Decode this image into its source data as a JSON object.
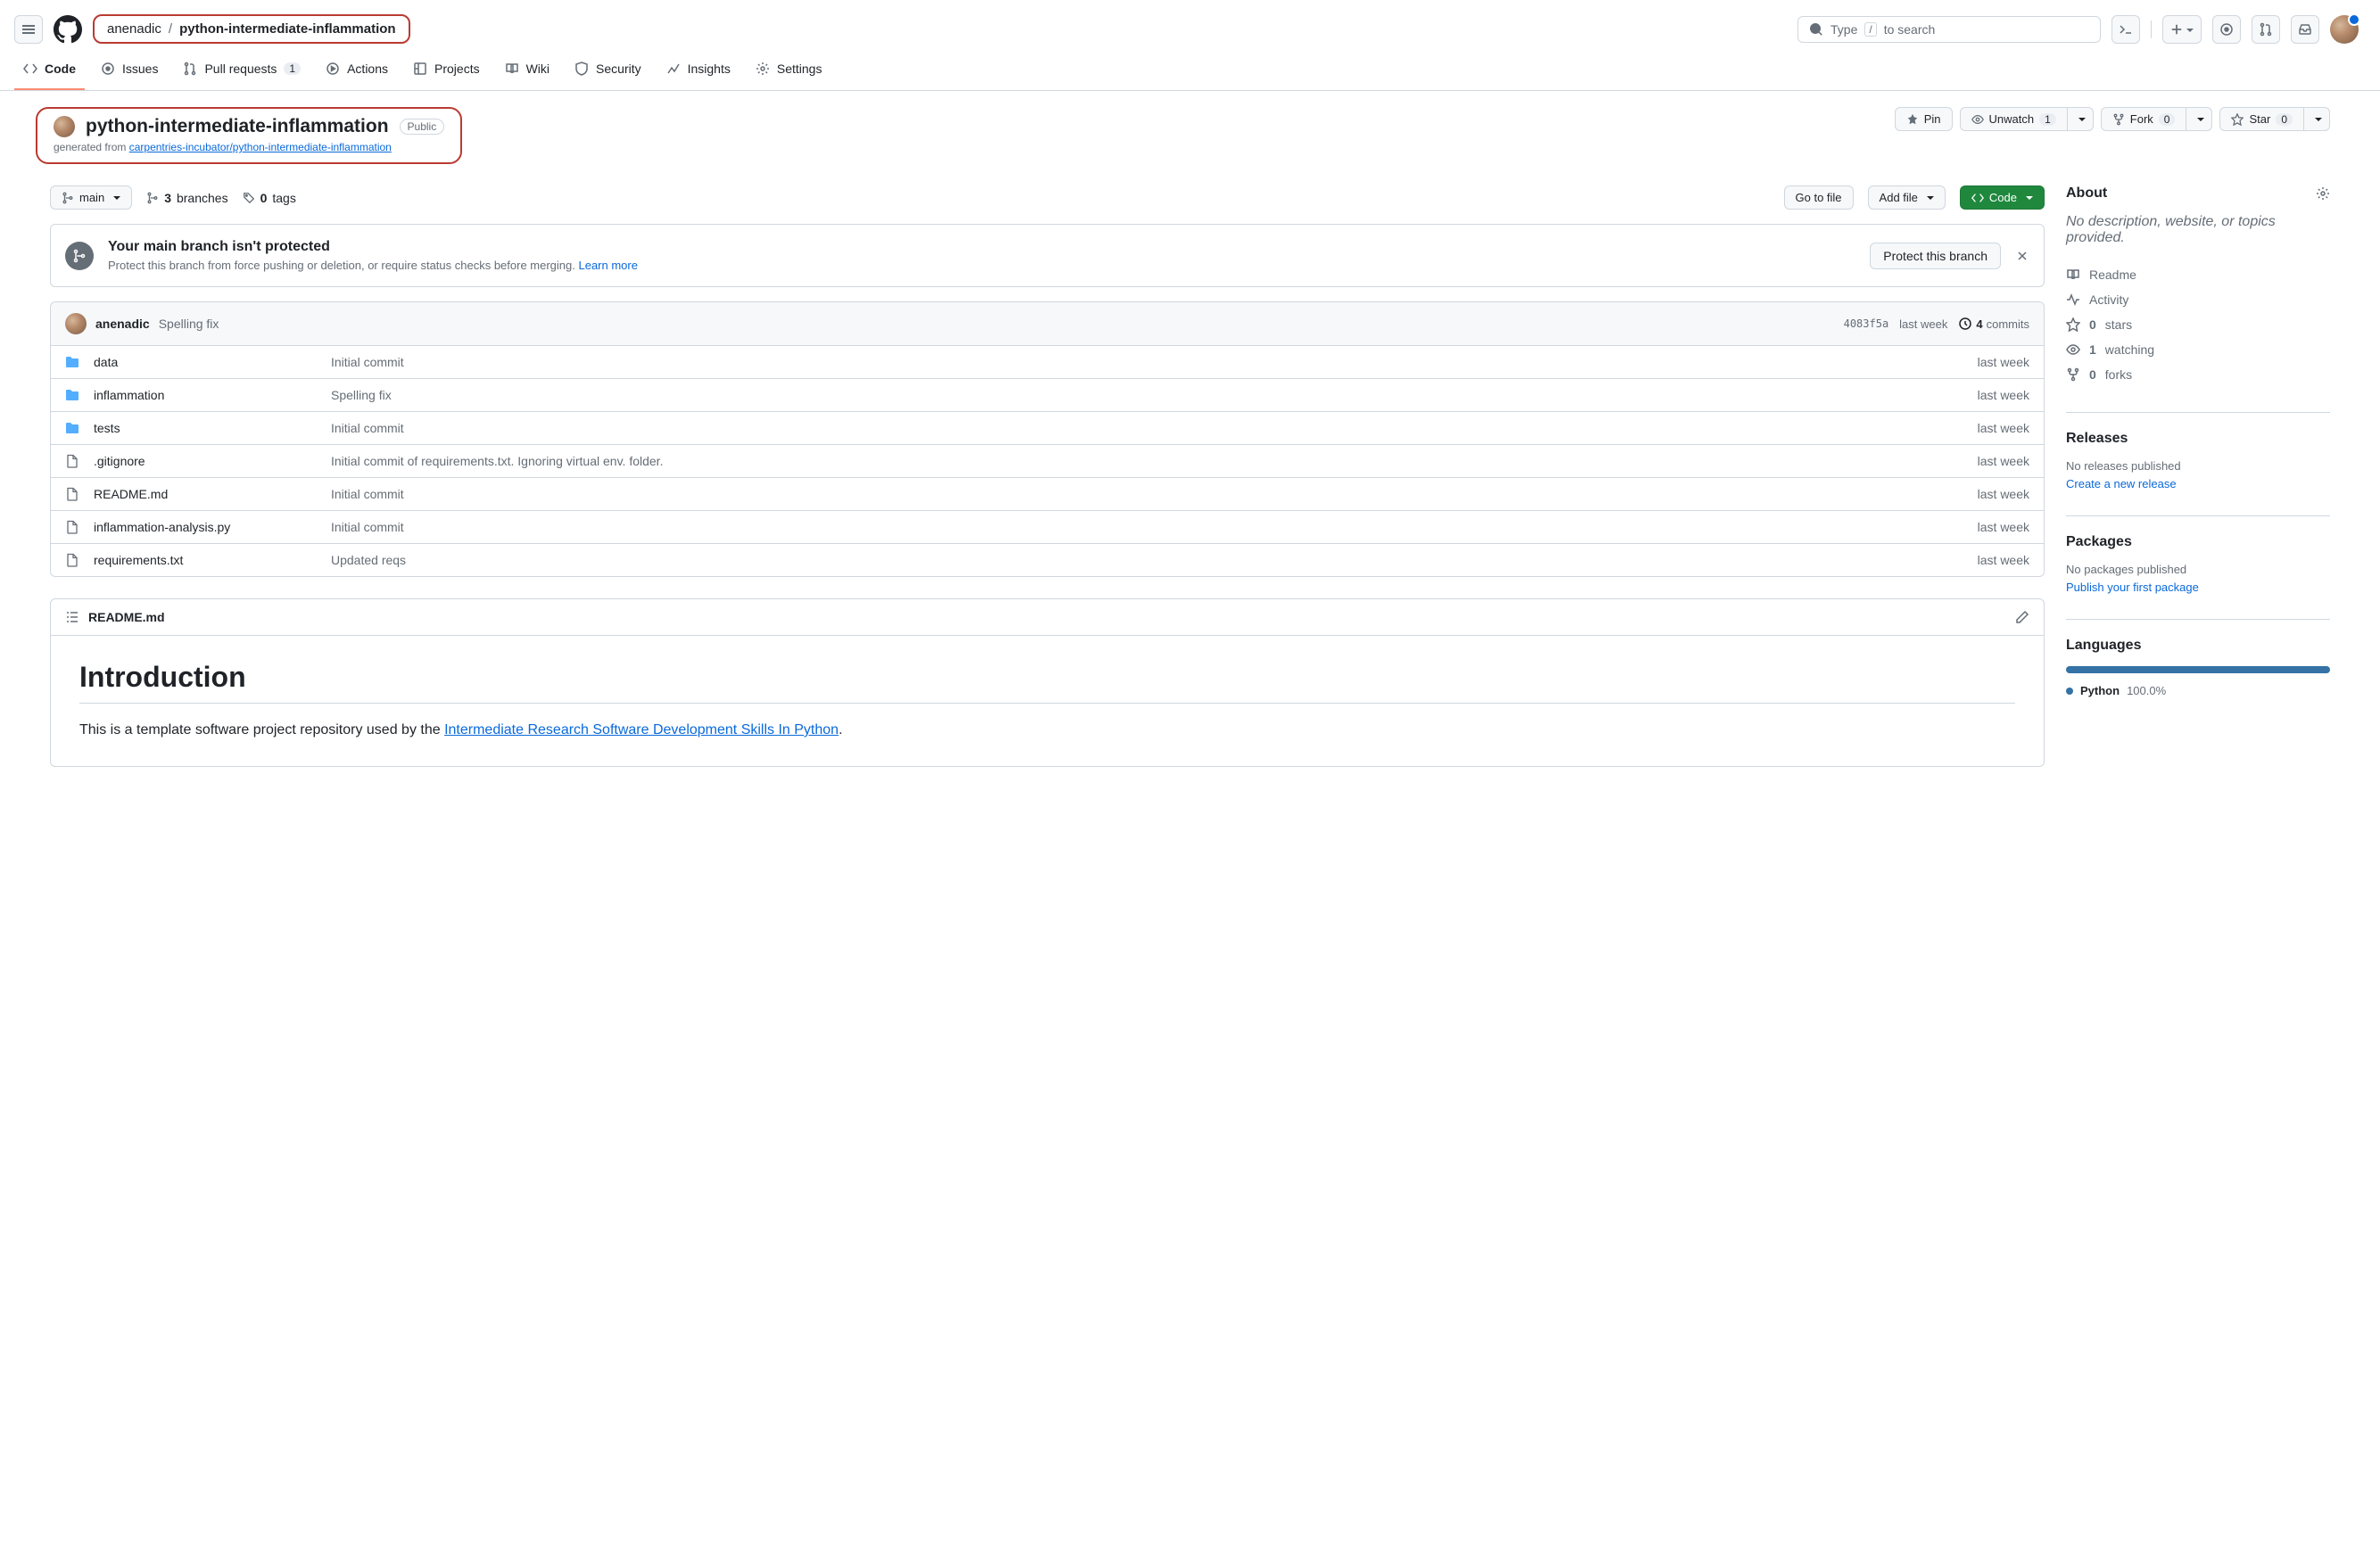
{
  "breadcrumb": {
    "owner": "anenadic",
    "sep": "/",
    "repo": "python-intermediate-inflammation"
  },
  "search": {
    "prefix": "Type",
    "key": "/",
    "suffix": "to search"
  },
  "nav": {
    "code": "Code",
    "issues": "Issues",
    "pulls": "Pull requests",
    "pulls_count": "1",
    "actions": "Actions",
    "projects": "Projects",
    "wiki": "Wiki",
    "security": "Security",
    "insights": "Insights",
    "settings": "Settings"
  },
  "title": {
    "name": "python-intermediate-inflammation",
    "visibility": "Public",
    "gen_prefix": "generated from ",
    "gen_link": "carpentries-incubator/python-intermediate-inflammation"
  },
  "actions": {
    "pin": "Pin",
    "unwatch": "Unwatch",
    "unwatch_count": "1",
    "fork": "Fork",
    "fork_count": "0",
    "star": "Star",
    "star_count": "0"
  },
  "filenav": {
    "branch": "main",
    "branches_n": "3",
    "branches_l": "branches",
    "tags_n": "0",
    "tags_l": "tags",
    "goto": "Go to file",
    "addfile": "Add file",
    "code": "Code"
  },
  "protect": {
    "title": "Your main branch isn't protected",
    "desc": "Protect this branch from force pushing or deletion, or require status checks before merging. ",
    "learn": "Learn more",
    "btn": "Protect this branch"
  },
  "commit_bar": {
    "author": "anenadic",
    "msg": "Spelling fix",
    "sha": "4083f5a",
    "when": "last week",
    "commits_n": "4",
    "commits_l": "commits"
  },
  "files": [
    {
      "type": "dir",
      "name": "data",
      "msg": "Initial commit",
      "when": "last week"
    },
    {
      "type": "dir",
      "name": "inflammation",
      "msg": "Spelling fix",
      "when": "last week"
    },
    {
      "type": "dir",
      "name": "tests",
      "msg": "Initial commit",
      "when": "last week"
    },
    {
      "type": "file",
      "name": ".gitignore",
      "msg": "Initial commit of requirements.txt. Ignoring virtual env. folder.",
      "when": "last week"
    },
    {
      "type": "file",
      "name": "README.md",
      "msg": "Initial commit",
      "when": "last week"
    },
    {
      "type": "file",
      "name": "inflammation-analysis.py",
      "msg": "Initial commit",
      "when": "last week"
    },
    {
      "type": "file",
      "name": "requirements.txt",
      "msg": "Updated reqs",
      "when": "last week"
    }
  ],
  "readme": {
    "filename": "README.md",
    "h1": "Introduction",
    "p_prefix": "This is a template software project repository used by the ",
    "p_link": "Intermediate Research Software Development Skills In Python",
    "p_suffix": "."
  },
  "about": {
    "title": "About",
    "desc": "No description, website, or topics provided.",
    "readme": "Readme",
    "activity": "Activity",
    "stars_n": "0",
    "stars_l": "stars",
    "watch_n": "1",
    "watch_l": "watching",
    "forks_n": "0",
    "forks_l": "forks"
  },
  "releases": {
    "title": "Releases",
    "note": "No releases published",
    "action": "Create a new release"
  },
  "packages": {
    "title": "Packages",
    "note": "No packages published",
    "action": "Publish your first package"
  },
  "languages": {
    "title": "Languages",
    "name": "Python",
    "pct": "100.0%"
  }
}
